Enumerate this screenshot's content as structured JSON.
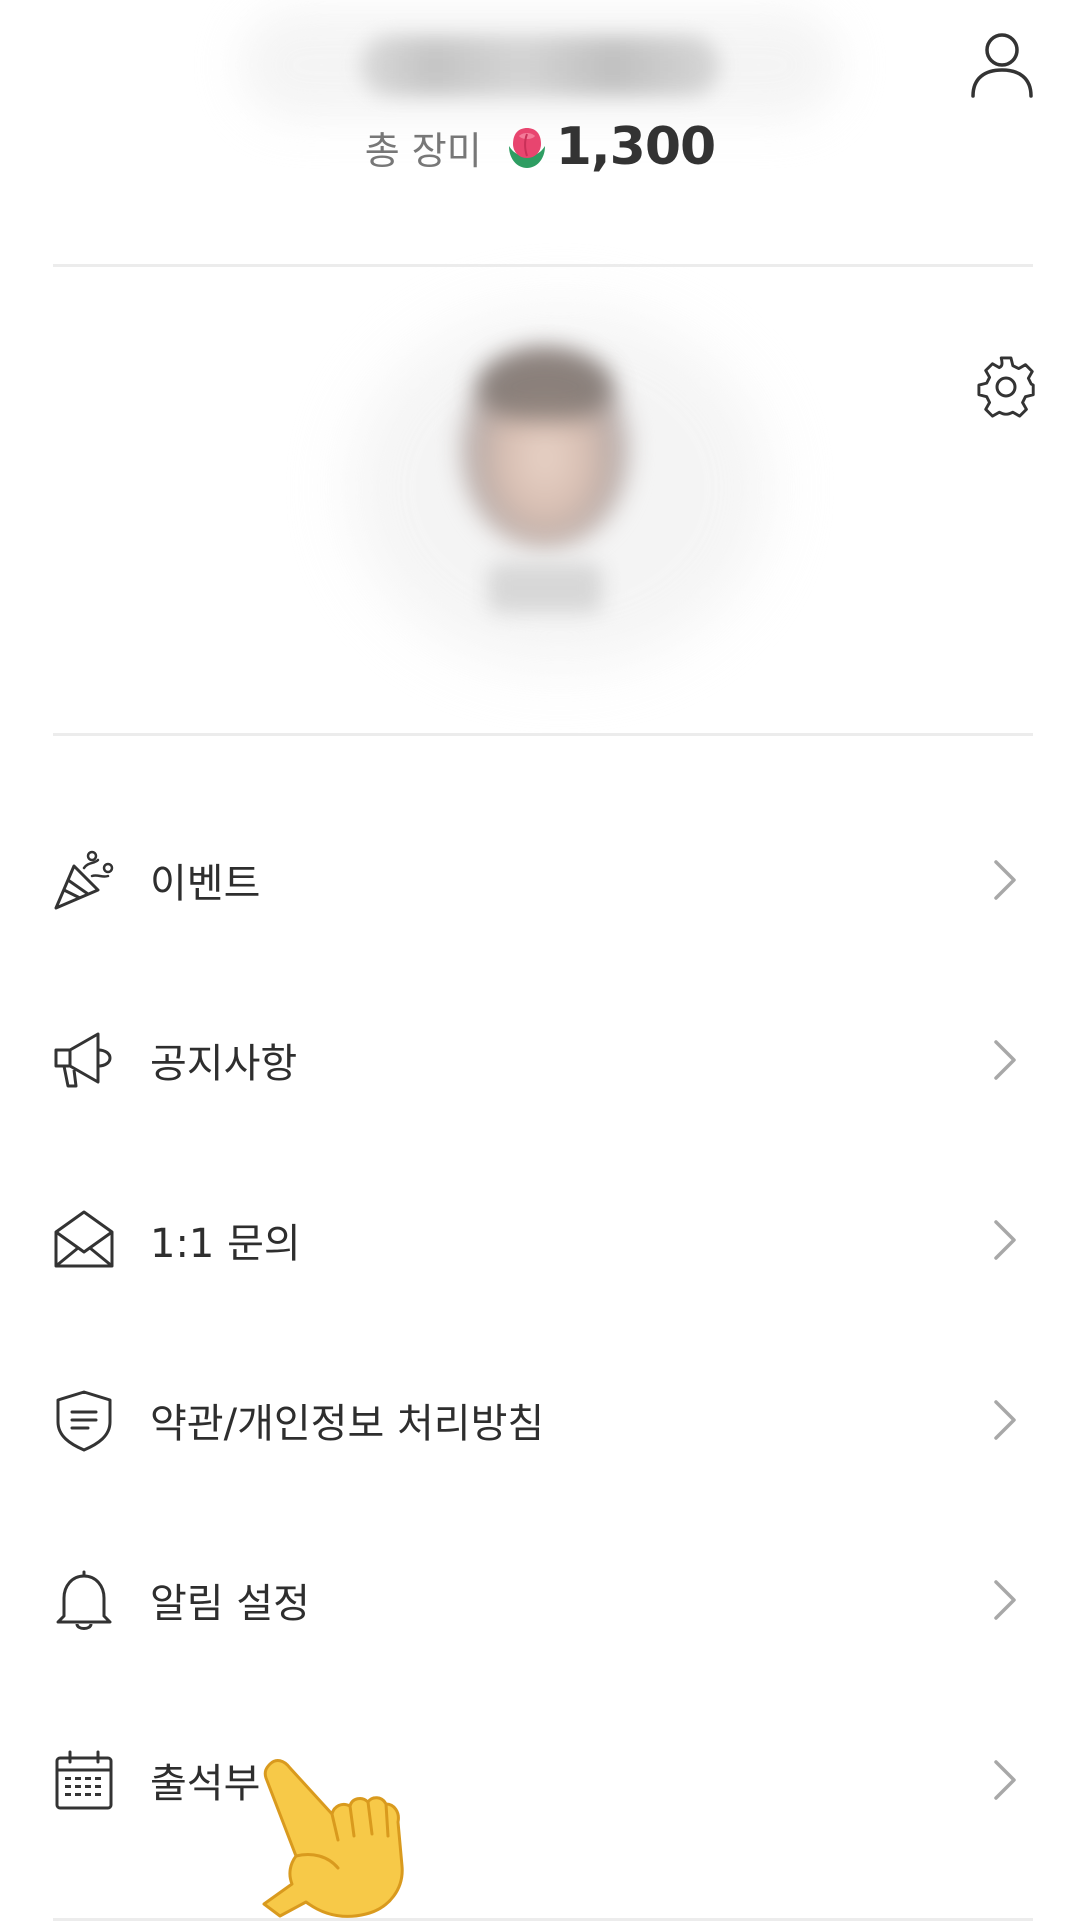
{
  "header": {
    "total_label": "총 장미",
    "total_value": "1,300"
  },
  "menu": {
    "items": [
      {
        "label": "이벤트",
        "icon": "party-popper-icon"
      },
      {
        "label": "공지사항",
        "icon": "megaphone-icon"
      },
      {
        "label": "1:1 문의",
        "icon": "envelope-icon"
      },
      {
        "label": "약관/개인정보 처리방침",
        "icon": "shield-document-icon"
      },
      {
        "label": "알림 설정",
        "icon": "bell-icon"
      },
      {
        "label": "출석부",
        "icon": "calendar-icon"
      }
    ]
  },
  "colors": {
    "text": "#2e2e2e",
    "muted": "#777777",
    "divider": "#ececec",
    "chevron": "#a8a8a8"
  }
}
